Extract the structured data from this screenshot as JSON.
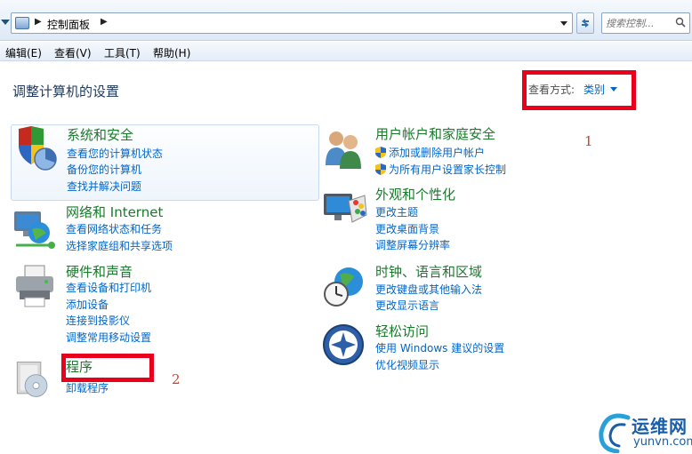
{
  "address_bar": {
    "breadcrumb": "控制面板",
    "search_placeholder": "搜索控制..."
  },
  "menu": [
    "编辑(E)",
    "查看(V)",
    "工具(T)",
    "帮助(H)"
  ],
  "page_title": "调整计算机的设置",
  "view_by": {
    "label": "查看方式:",
    "value": "类别"
  },
  "categories": [
    {
      "title": "系统和安全",
      "icon": "shield-chart-icon",
      "links": [
        "查看您的计算机状态",
        "备份您的计算机",
        "查找并解决问题"
      ]
    },
    {
      "title": "网络和 Internet",
      "icon": "network-globe-icon",
      "links": [
        "查看网络状态和任务",
        "选择家庭组和共享选项"
      ]
    },
    {
      "title": "硬件和声音",
      "icon": "printer-icon",
      "links": [
        "查看设备和打印机",
        "添加设备",
        "连接到投影仪",
        "调整常用移动设置"
      ]
    },
    {
      "title": "程序",
      "icon": "programs-cd-icon",
      "links": [
        "卸载程序"
      ]
    },
    {
      "title": "用户帐户和家庭安全",
      "icon": "users-icon",
      "links": [
        "添加或删除用户帐户",
        "为所有用户设置家长控制"
      ]
    },
    {
      "title": "外观和个性化",
      "icon": "monitor-palette-icon",
      "links": [
        "更改主题",
        "更改桌面背景",
        "调整屏幕分辨率"
      ]
    },
    {
      "title": "时钟、语言和区域",
      "icon": "clock-globe-icon",
      "links": [
        "更改键盘或其他输入法",
        "更改显示语言"
      ]
    },
    {
      "title": "轻松访问",
      "icon": "ease-of-access-icon",
      "links": [
        "使用 Windows 建议的设置",
        "优化视频显示"
      ]
    }
  ],
  "annotations": [
    "1",
    "2"
  ],
  "watermark": {
    "cn": "运维网",
    "en": "yunvn.com"
  },
  "colors": {
    "category_title": "#1a7a2c",
    "link": "#0066cc",
    "annotation_box": "#e8001c"
  }
}
